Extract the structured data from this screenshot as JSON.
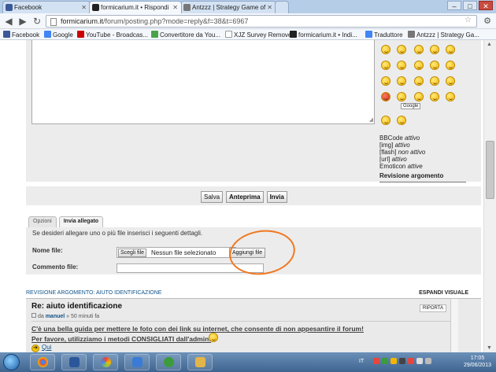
{
  "browser": {
    "tabs": [
      {
        "label": "Facebook",
        "icon": "facebook-icon",
        "color": "#3b5998"
      },
      {
        "label": "formicarium.it • Rispondi",
        "icon": "ant-icon",
        "color": "#222222"
      },
      {
        "label": "Antzzz | Strategy Game of",
        "icon": "antzzz-icon",
        "color": "#666666"
      }
    ],
    "url_host": "formicarium.it",
    "url_path": "/forum/posting.php?mode=reply&f=38&t=6967",
    "window_controls": [
      "–",
      "□",
      "✕"
    ]
  },
  "bookmarks": [
    {
      "label": "Facebook",
      "color": "#3b5998"
    },
    {
      "label": "Google",
      "color": "#4285f4"
    },
    {
      "label": "YouTube - Broadcas...",
      "color": "#cc0000"
    },
    {
      "label": "Convertitore da You...",
      "color": "#4aa34a"
    },
    {
      "label": "XJZ Survey Remover",
      "color": "#bbbbbb"
    },
    {
      "label": "formicarium.it • Indi...",
      "color": "#222222"
    },
    {
      "label": "Traduttore",
      "color": "#4285f4"
    },
    {
      "label": "Antzzz | Strategy Ga...",
      "color": "#666666"
    }
  ],
  "posting": {
    "status_lines": [
      {
        "label": "BBCode",
        "state": "attivo"
      },
      {
        "label": "[img]",
        "state": "attivo"
      },
      {
        "label": "[flash]",
        "state": "non attivo"
      },
      {
        "label": "[url]",
        "state": "attivo"
      },
      {
        "label": "Emoticon",
        "state": "attive"
      }
    ],
    "revision_label": "Revisione argomento",
    "google_badge": "Google",
    "buttons": {
      "save": "Salva",
      "preview": "Anteprima",
      "submit": "Invia"
    }
  },
  "attachments": {
    "tabs": [
      "Opzioni",
      "Invia allegato"
    ],
    "description": "Se desideri allegare uno o più file inserisci i seguenti dettagli.",
    "file_label": "Nome file:",
    "choose_button": "Scegli file",
    "no_file": "Nessun file selezionato",
    "add_button": "Aggiungi file",
    "comment_label": "Commento file:"
  },
  "review": {
    "header": "REVISIONE ARGOMENTO: AIUTO IDENTIFICAZIONE",
    "expand": "ESPANDI VISUALE",
    "post_title": "Re: aiuto identificazione",
    "by_prefix": "da",
    "author": "manuel",
    "time": "» 50 minuti fa",
    "quote_button": "RIPORTA",
    "line1": "C'è una bella guida per mettere le foto con dei link su internet, che consente di non appesantire il forum!",
    "line2": "Per favore, utilizziamo i metodi CONSIGLIATI dall'admin!",
    "link": "Qui"
  },
  "taskbar": {
    "language": "IT",
    "time": "17:05",
    "date": "29/06/2013",
    "apps": [
      {
        "name": "chrome-icon",
        "color": "#e8453c"
      },
      {
        "name": "word-icon",
        "color": "#2b579a"
      },
      {
        "name": "picasa-icon",
        "color": "#8bc34a"
      },
      {
        "name": "photo-viewer-icon",
        "color": "#3a7bd5"
      },
      {
        "name": "utorrent-icon",
        "color": "#3c9b3c"
      },
      {
        "name": "file-explorer-icon",
        "color": "#e2b54a"
      }
    ]
  }
}
